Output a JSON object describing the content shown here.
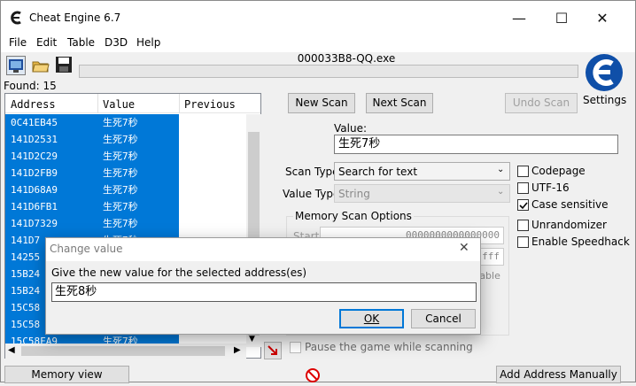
{
  "window": {
    "title": "Cheat Engine 6.7",
    "process": "000033B8-QQ.exe"
  },
  "menu": [
    "File",
    "Edit",
    "Table",
    "D3D",
    "Help"
  ],
  "found": "Found: 15",
  "columns": {
    "address": "Address",
    "value": "Value",
    "previous": "Previous"
  },
  "rows": [
    {
      "address": "0C41EB45",
      "value": "生死7秒"
    },
    {
      "address": "141D2531",
      "value": "生死7秒"
    },
    {
      "address": "141D2C29",
      "value": "生死7秒"
    },
    {
      "address": "141D2FB9",
      "value": "生死7秒"
    },
    {
      "address": "141D68A9",
      "value": "生死7秒"
    },
    {
      "address": "141D6FB1",
      "value": "生死7秒"
    },
    {
      "address": "141D7329",
      "value": "生死7秒"
    },
    {
      "address": "141D7",
      "value": "生死7秒"
    },
    {
      "address": "14255",
      "value": ""
    },
    {
      "address": "15B24",
      "value": ""
    },
    {
      "address": "15B24",
      "value": ""
    },
    {
      "address": "15C58",
      "value": ""
    },
    {
      "address": "15C58",
      "value": ""
    },
    {
      "address": "15C58FA9",
      "value": "生死7秒"
    }
  ],
  "buttons": {
    "new_scan": "New Scan",
    "next_scan": "Next Scan",
    "undo_scan": "Undo Scan",
    "memory_view": "Memory view",
    "add_address": "Add Address Manually"
  },
  "settings_label": "Settings",
  "value_label": "Value:",
  "value_text": "生死7秒",
  "scan_type": {
    "label": "Scan Type",
    "selected": "Search for text"
  },
  "value_type": {
    "label": "Value Type",
    "selected": "String"
  },
  "options": [
    {
      "label": "Codepage",
      "checked": false
    },
    {
      "label": "UTF-16",
      "checked": false
    },
    {
      "label": "Case sensitive",
      "checked": true
    },
    {
      "label": "Unrandomizer",
      "checked": false
    },
    {
      "label": "Enable Speedhack",
      "checked": false
    }
  ],
  "memory_options": {
    "title": "Memory Scan Options",
    "start_label": "Start",
    "start_value": "0000000000000000",
    "stop_value_tail": "fff",
    "executable_tail": "table"
  },
  "pause_label": "Pause the game while scanning",
  "dialog": {
    "title": "Change value",
    "prompt": "Give the new value for the selected address(es)",
    "input_value": "生死8秒",
    "ok": "OK",
    "cancel": "Cancel"
  },
  "colors": {
    "selection": "#0078d7",
    "dialog_border": "#0078d7"
  }
}
